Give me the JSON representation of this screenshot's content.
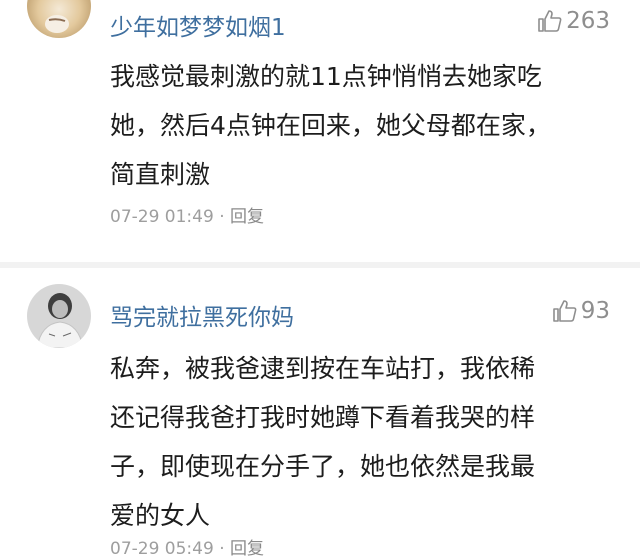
{
  "comments": [
    {
      "username": "少年如梦梦如烟1",
      "likes": "263",
      "lines": [
        "我感觉最刺激的就11点钟悄悄去她家吃",
        "她，然后4点钟在回来，她父母都在家，",
        "简直刺激"
      ],
      "time": "07-29 01:49",
      "separator": "·",
      "reply_label": "回复",
      "avatar_icon": "user-avatar-blonde"
    },
    {
      "username": "骂完就拉黑死你妈",
      "likes": "93",
      "lines": [
        "私奔，被我爸逮到按在车站打，我依稀",
        "还记得我爸打我时她蹲下看着我哭的样",
        "子，即使现在分手了，她也依然是我最",
        "爱的女人"
      ],
      "time": "07-29 05:49",
      "separator": "·",
      "reply_label": "回复",
      "avatar_icon": "user-avatar-gray"
    }
  ],
  "colors": {
    "username": "#3f6f9f",
    "text": "#1d1d1d",
    "meta": "#9e9e9e",
    "like": "#8e8e8e",
    "divider": "#f2f2f2"
  },
  "icons": {
    "like": "thumbs-up-icon"
  }
}
